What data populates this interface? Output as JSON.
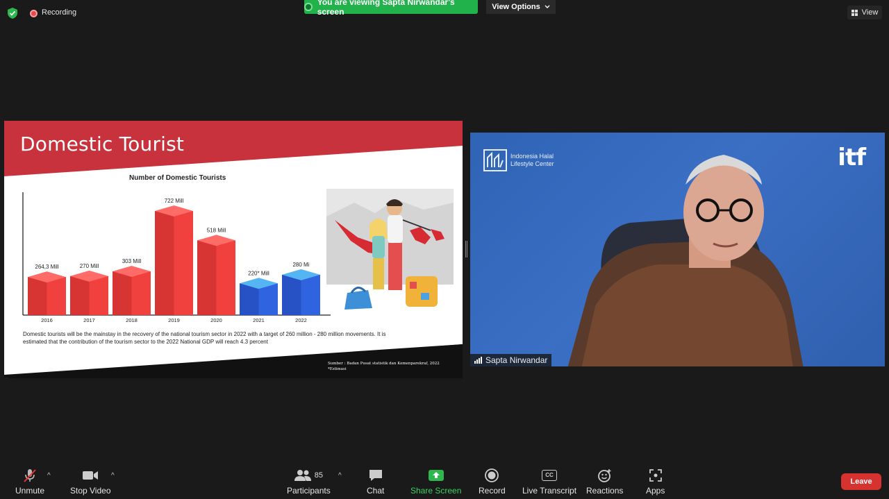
{
  "top_bar": {
    "recording_label": "Recording",
    "viewing_banner": "You are viewing Sapta Nirwandar's screen",
    "view_options": "View Options",
    "view_button": "View"
  },
  "slide": {
    "title": "Domestic Tourist",
    "description": "Domestic tourists will be the mainstay in the recovery of the national tourism sector in 2022 with a target of 260 million - 280 million movements. It is estimated that the contribution of the tourism sector to the 2022 National GDP will reach 4.3 percent",
    "source_line1": "Sumber : Badan Pusat statistik dan Kemenparekraf, 2022",
    "source_line2": "*Estimasi",
    "colors": {
      "header_red": "#c8323c",
      "bar_red": "#f0413f",
      "bar_blue": "#2f63e0"
    }
  },
  "chart_data": {
    "type": "bar",
    "title": "Number of Domestic Tourists",
    "categories": [
      "2016",
      "2017",
      "2018",
      "2019",
      "2020",
      "2021",
      "2022"
    ],
    "values": [
      264.3,
      270,
      303,
      722,
      518,
      220,
      280
    ],
    "data_labels": [
      "264,3 Mill",
      "270 Mill",
      "303 Mill",
      "722 Mill",
      "518 Mill",
      "220* Mill",
      "280 Mi"
    ],
    "bar_colors": [
      "red",
      "red",
      "red",
      "red",
      "red",
      "blue",
      "blue"
    ],
    "xlabel": "",
    "ylabel": ""
  },
  "video": {
    "participant_name": "Sapta Nirwandar",
    "logo_text_line1": "Indonesia Halal",
    "logo_text_line2": "Lifestyle Center",
    "brand_logo": "itf"
  },
  "toolbar": {
    "unmute": "Unmute",
    "stop_video": "Stop Video",
    "participants": "Participants",
    "participants_count": "85",
    "chat": "Chat",
    "share_screen": "Share Screen",
    "record": "Record",
    "live_transcript": "Live Transcript",
    "cc_icon_text": "CC",
    "reactions": "Reactions",
    "apps": "Apps",
    "leave": "Leave"
  }
}
